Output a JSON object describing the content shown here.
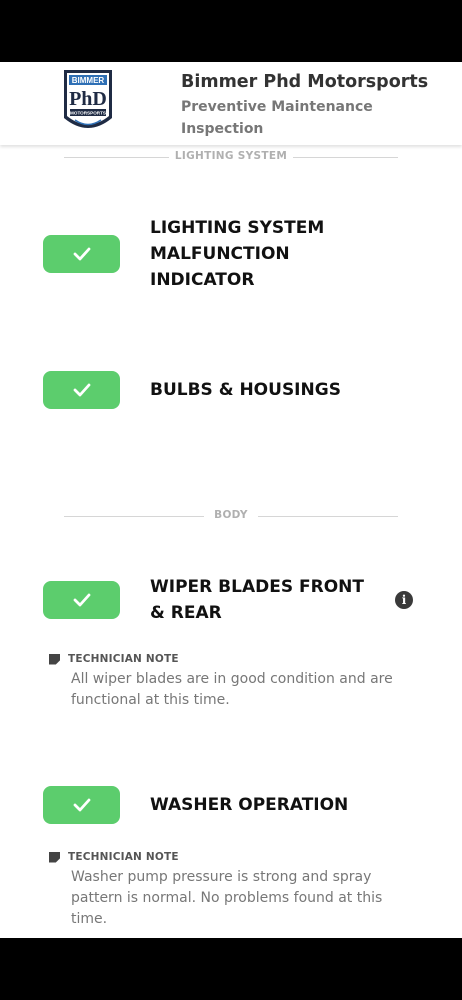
{
  "header": {
    "logo_text": [
      "BIMMER",
      "PhD",
      "MOTORSPORTS"
    ],
    "shop_name": "Bimmer Phd Motorsports",
    "report_title": "Preventive Maintenance Inspection"
  },
  "sections": [
    {
      "label": "LIGHTING SYSTEM",
      "items": [
        {
          "title": "LIGHTING SYSTEM MALFUNCTION INDICATOR",
          "status": "pass"
        },
        {
          "title": "BULBS & HOUSINGS",
          "status": "pass"
        }
      ]
    },
    {
      "label": "BODY",
      "items": [
        {
          "title": "WIPER BLADES FRONT & REAR",
          "status": "pass",
          "has_info": true,
          "note_label": "TECHNICIAN NOTE",
          "note": "All wiper blades are in good condition and are functional at this time."
        },
        {
          "title": "WASHER OPERATION",
          "status": "pass",
          "note_label": "TECHNICIAN NOTE",
          "note": "Washer pump pressure is strong and spray pattern is normal. No problems found at this time."
        }
      ]
    }
  ],
  "colors": {
    "pass_green": "#5ccd6d",
    "title": "#111111",
    "muted": "#777777"
  },
  "icons": {
    "check": "check-icon",
    "info": "info-icon",
    "note": "note-icon"
  }
}
